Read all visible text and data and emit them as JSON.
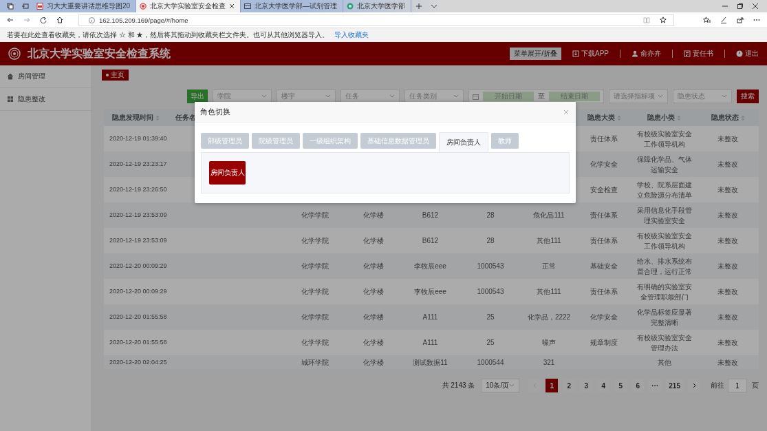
{
  "browser": {
    "tabs": [
      {
        "kind": "pdf",
        "title": "习大大重要讲话思维导图20",
        "selected": false
      },
      {
        "kind": "seal",
        "title": "北京大学实验室安全检查",
        "selected": true
      },
      {
        "kind": "page",
        "title": "北京大学医学部—试剂管理",
        "selected": false
      },
      {
        "kind": "logo",
        "title": "北京大学医学部",
        "selected": false
      }
    ],
    "address": "162.105.209.169/page/#/home",
    "favorites_hint": "若要在此处查看收藏夹，请依次选择 ☆ 和 ★，然后将其拖动到收藏夹栏文件夹。也可从其他浏览器导入。",
    "favorites_link": "导入收藏夹"
  },
  "header": {
    "title": "北京大学实验室安全检查系统",
    "menu_toggle": "菜单展开/折叠",
    "actions": [
      {
        "kind": "download",
        "label": "下载APP"
      },
      {
        "kind": "user",
        "label": "俞亦卉"
      },
      {
        "kind": "document",
        "label": "责任书"
      },
      {
        "kind": "logout",
        "label": "退出"
      }
    ]
  },
  "sidebar": {
    "items": [
      {
        "kind": "home",
        "label": "房间管理"
      },
      {
        "kind": "grid",
        "label": "隐患整改"
      }
    ]
  },
  "breadcrumb": "主页",
  "filters": {
    "export": "导出",
    "selects": [
      "学院",
      "楼宇",
      "任务",
      "任务类别"
    ],
    "date_start": "开始日期",
    "date_separator": "至",
    "date_end": "结束日期",
    "selects_after": [
      "请选择指标项",
      "隐患状态"
    ],
    "search": "搜索"
  },
  "table": {
    "columns": [
      {
        "label": "隐患发现时间",
        "sortable": true
      },
      {
        "label": "任务名"
      },
      null,
      null,
      null,
      null,
      null,
      {
        "label": "隐患大类",
        "sortable": true
      },
      {
        "label": "隐患小类",
        "sortable": true
      },
      {
        "label": "隐患状态",
        "sortable": true
      }
    ],
    "rows": [
      {
        "cells": [
          "2020-12-19 01:39:40",
          null,
          null,
          null,
          null,
          null,
          null,
          "责任体系",
          "有校级实验室安全工作领导机构",
          "未整改"
        ]
      },
      {
        "cells": [
          "2020-12-19 23:23:17",
          null,
          null,
          null,
          null,
          null,
          null,
          "化学安全",
          "保障化学品、气体运输安全",
          "未整改"
        ]
      },
      {
        "cells": [
          "2020-12-19 23:26:50",
          null,
          null,
          null,
          null,
          null,
          null,
          "安全检查",
          "学校、院系层面建立危险源分布清单",
          "未整改"
        ]
      },
      {
        "cells": [
          "2020-12-19 23:53:09",
          null,
          "化学学院",
          "化学楼",
          "B612",
          "28",
          "危化品111",
          "责任体系",
          "采用信息化手段管理实验室安全",
          "未整改"
        ]
      },
      {
        "cells": [
          "2020-12-19 23:53:09",
          null,
          "化学学院",
          "化学楼",
          "B612",
          "28",
          "其他111",
          "责任体系",
          "有校级实验室安全工作领导机构",
          "未整改"
        ]
      },
      {
        "cells": [
          "2020-12-20 00:09:29",
          null,
          "化学学院",
          "化学楼",
          "李牧辰eee",
          "1000543",
          "正常",
          "基础安全",
          "给水、排水系统布置合理，运行正常",
          "未整改"
        ]
      },
      {
        "cells": [
          "2020-12-20 00:09:29",
          null,
          "化学学院",
          "化学楼",
          "李牧辰eee",
          "1000543",
          "其他111",
          "责任体系",
          "有明确的实验室安全管理职能部门",
          "未整改"
        ]
      },
      {
        "cells": [
          "2020-12-20 01:55:58",
          null,
          "化学学院",
          "化学楼",
          "A111",
          "25",
          "化学品，2222",
          "化学安全",
          "化学品标签应显著完整清晰",
          "未整改"
        ]
      },
      {
        "cells": [
          "2020-12-20 01:55:58",
          null,
          "化学学院",
          "化学楼",
          "A111",
          "25",
          "噪声",
          "规章制度",
          "有校级实验室安全管理办法",
          "未整改"
        ]
      },
      {
        "cells": [
          "2020-12-20 02:04:25",
          null,
          "城环学院",
          "化学楼",
          "测试数据11",
          "1000544",
          "321",
          null,
          "其他",
          "未整改"
        ]
      }
    ]
  },
  "pagination": {
    "total": "共 2143 条",
    "page_size": "10条/页",
    "pages": [
      {
        "label": "1",
        "selected": true
      },
      {
        "label": "2",
        "selected": false
      },
      {
        "label": "3",
        "selected": false
      },
      {
        "label": "4",
        "selected": false
      },
      {
        "label": "5",
        "selected": false
      },
      {
        "label": "6",
        "selected": false
      },
      {
        "label": "···",
        "selected": false
      },
      {
        "label": "215",
        "selected": false
      }
    ],
    "goto": "前往",
    "goto_value": "1",
    "goto_unit": "页"
  },
  "dialog": {
    "title": "角色切换",
    "tabs": [
      {
        "label": "部级管理员",
        "selected": false
      },
      {
        "label": "院级管理员",
        "selected": false
      },
      {
        "label": "一级组织架构",
        "selected": false
      },
      {
        "label": "基础信息数据管理员",
        "selected": false
      },
      {
        "label": "房间负责人",
        "selected": true
      },
      {
        "label": "教师",
        "selected": false
      }
    ],
    "roles": [
      "房间负责人"
    ]
  }
}
